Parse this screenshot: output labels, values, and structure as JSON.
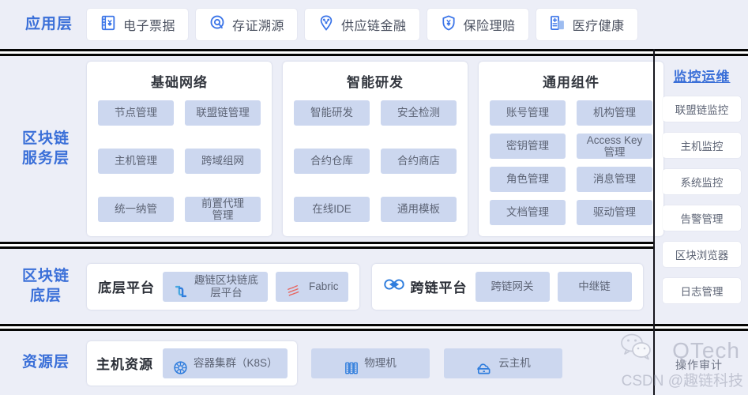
{
  "colors": {
    "page_bg": "#eceef7",
    "accent_blue": "#3a6fd8",
    "chip_bg": "#ccd7ef",
    "card_bg": "#ffffff",
    "text_gray": "#5d6475",
    "divider": "#050505"
  },
  "application_layer": {
    "label": "应用层",
    "cards": [
      {
        "label": "电子票据",
        "icon": "invoice-yen-icon"
      },
      {
        "label": "存证溯源",
        "icon": "fingerprint-trace-icon"
      },
      {
        "label": "供应链金融",
        "icon": "supply-chain-node-icon"
      },
      {
        "label": "保险理赔",
        "icon": "shield-yen-icon"
      },
      {
        "label": "医疗健康",
        "icon": "hospital-building-icon"
      }
    ]
  },
  "service_layer": {
    "label": "区块链\n服务层",
    "label_line1": "区块链",
    "label_line2": "服务层",
    "panels": [
      {
        "title": "基础网络",
        "chips": [
          "节点管理",
          "联盟链管理",
          "主机管理",
          "跨域组网",
          "统一纳管",
          "前置代理\n管理"
        ]
      },
      {
        "title": "智能研发",
        "chips": [
          "智能研发",
          "安全检测",
          "合约仓库",
          "合约商店",
          "在线IDE",
          "通用模板"
        ]
      },
      {
        "title": "通用组件",
        "chips": [
          "账号管理",
          "机构管理",
          "密钥管理",
          "Access Key\n管理",
          "角色管理",
          "消息管理",
          "文档管理",
          "驱动管理"
        ]
      }
    ]
  },
  "monitor_column": {
    "title": "监控运维",
    "items": [
      "联盟链监控",
      "主机监控",
      "系统监控",
      "告警管理",
      "区块浏览器",
      "日志管理",
      "操作审计"
    ]
  },
  "chain_layer": {
    "label_line1": "区块链",
    "label_line2": "底层",
    "groups": [
      {
        "title": "底层平台",
        "title_icon": "",
        "pills": [
          {
            "label": "趣链区块链底\n层平台",
            "icon": "hyperchain-logo-icon"
          },
          {
            "label": "Fabric",
            "icon": "fabric-logo-icon"
          }
        ]
      },
      {
        "title": "跨链平台",
        "title_icon": "cross-chain-logo-icon",
        "pills": [
          {
            "label": "跨链网关",
            "icon": ""
          },
          {
            "label": "中继链",
            "icon": ""
          }
        ]
      }
    ]
  },
  "resource_layer": {
    "label": "资源层",
    "group_title": "主机资源",
    "items": [
      {
        "label": "容器集群（K8S）",
        "icon": "kubernetes-helm-icon"
      },
      {
        "label": "物理机",
        "icon": "server-rack-icon"
      },
      {
        "label": "云主机",
        "icon": "cloud-server-icon"
      }
    ]
  },
  "watermark": {
    "brand": "QTech",
    "csdn": "CSDN @趣链科技",
    "wechat_icon": "wechat-icon"
  }
}
